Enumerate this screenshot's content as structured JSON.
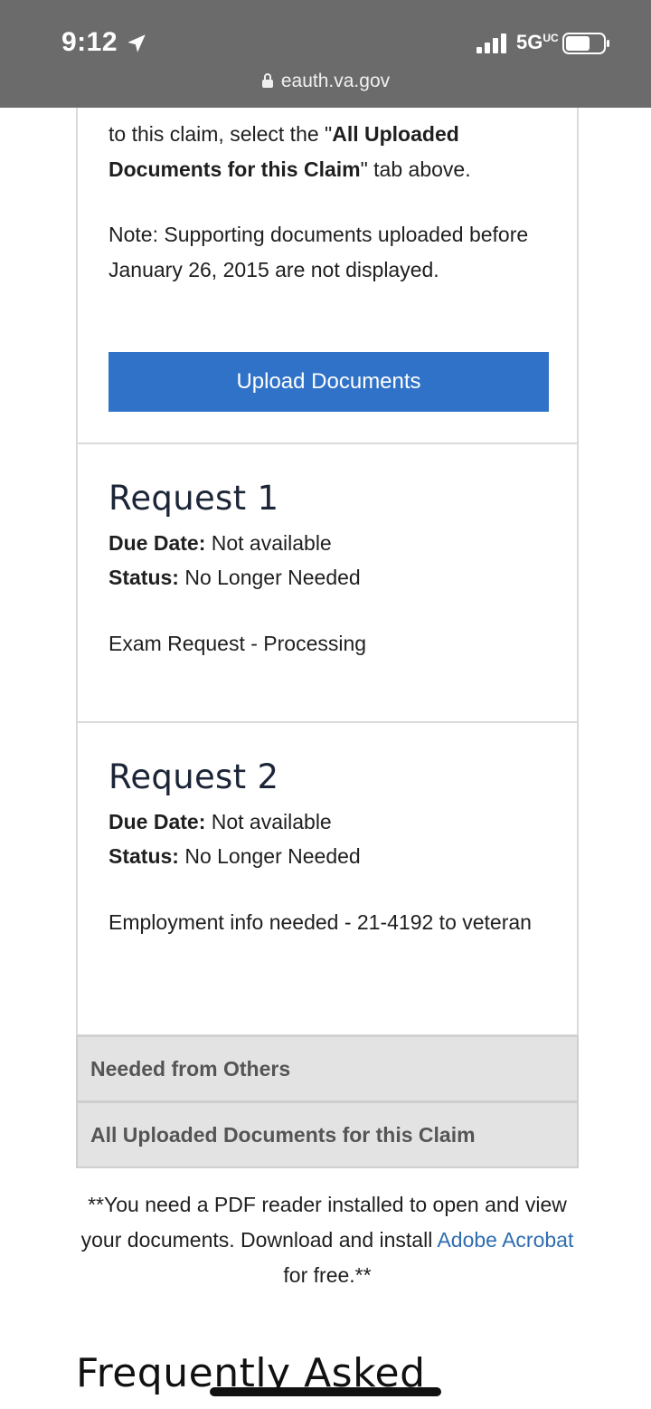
{
  "status_bar": {
    "time": "9:12",
    "network": "5G",
    "url": "eauth.va.gov"
  },
  "intro": {
    "line_prefix": "to this claim, select the \"",
    "bold_tab": "All Uploaded Documents for this Claim",
    "line_suffix": "\" tab above.",
    "note": "Note: Supporting documents uploaded before January 26, 2015 are not displayed.",
    "upload_button": "Upload Documents"
  },
  "requests": [
    {
      "title": "Request 1",
      "due_label": "Due Date:",
      "due_value": "Not available",
      "status_label": "Status:",
      "status_value": "No Longer Needed",
      "description": "Exam Request - Processing"
    },
    {
      "title": "Request 2",
      "due_label": "Due Date:",
      "due_value": "Not available",
      "status_label": "Status:",
      "status_value": "No Longer Needed",
      "description": "Employment info needed - 21-4192 to veteran"
    }
  ],
  "tabs": [
    {
      "label": "Needed from Others"
    },
    {
      "label": "All Uploaded Documents for this Claim"
    }
  ],
  "pdf_note": {
    "prefix": "**You need a PDF reader installed to open and view your documents. Download and install ",
    "link": "Adobe Acrobat",
    "suffix": " for free.**"
  },
  "faq_heading": "Frequently Asked",
  "colors": {
    "status_bar_bg": "#6b6b6b",
    "button_blue": "#2f72c8",
    "link_blue": "#2f6db0",
    "tab_bg": "#e3e3e3"
  },
  "icons": {
    "location": "location-arrow-icon",
    "signal": "cellular-signal-icon",
    "battery": "battery-icon",
    "lock": "lock-icon"
  }
}
